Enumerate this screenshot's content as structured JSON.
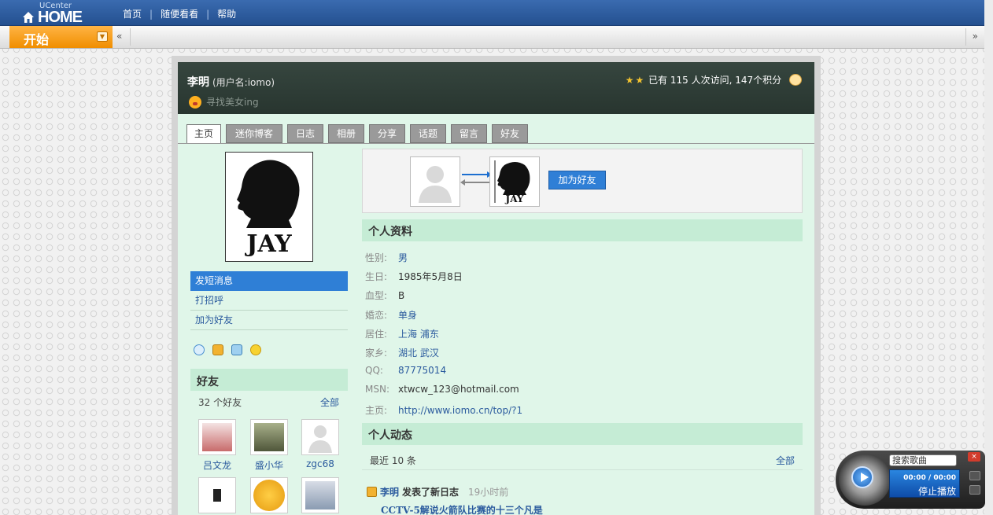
{
  "logo": {
    "small": "UCenter",
    "big": "HOME"
  },
  "topnav": [
    "首页",
    "随便看看",
    "帮助"
  ],
  "toolbar": {
    "start_label": "开始",
    "left_arrow": "«",
    "right_arrow": "»"
  },
  "profile": {
    "name": "李明",
    "username": "(用户名:iomo)",
    "motto": "寻找美女ing",
    "stats": "已有 115 人次访问, 147个积分",
    "avatar_text": "JAY"
  },
  "tabs": [
    "主页",
    "迷你博客",
    "日志",
    "相册",
    "分享",
    "话题",
    "留言",
    "好友"
  ],
  "actions": [
    "发短消息",
    "打招呼",
    "加为好友"
  ],
  "friends": {
    "title": "好友",
    "count": "32 个好友",
    "all": "全部",
    "list": [
      {
        "name": "吕文龙",
        "color": "#c86b6b"
      },
      {
        "name": "盛小华",
        "color": "#6f7a55"
      },
      {
        "name": "zgc68",
        "color": "#e3e3e3"
      },
      {
        "name": "",
        "color": "#222222"
      },
      {
        "name": "",
        "color": "#e59a10"
      },
      {
        "name": "",
        "color": "#8a9bb2"
      }
    ]
  },
  "relation": {
    "add_friend": "加为好友",
    "thumb_text": "JAY"
  },
  "personal_info": {
    "title": "个人资料",
    "rows": [
      {
        "k": "性别:",
        "v": "男",
        "link": true
      },
      {
        "k": "生日:",
        "v": "1985年5月8日",
        "link": false
      },
      {
        "k": "血型:",
        "v": "B",
        "link": false
      },
      {
        "k": "婚恋:",
        "v": "单身",
        "link": true
      },
      {
        "k": "居住:",
        "v": "上海  浦东",
        "link": true
      },
      {
        "k": "家乡:",
        "v": "湖北  武汉",
        "link": true
      },
      {
        "k": "QQ:",
        "v": "87775014",
        "link": true
      },
      {
        "k": "MSN:",
        "v": "xtwcw_123@hotmail.com",
        "link": false
      },
      {
        "k": "主页:",
        "v": "http://www.iomo.cn/top/?1",
        "link": true
      }
    ]
  },
  "activity": {
    "title": "个人动态",
    "meta": "最近  10 条",
    "all": "全部",
    "feed_user": "李明",
    "feed_action": "发表了新日志",
    "feed_time": "19小时前",
    "feed_title": "CCTV-5解说火箭队比赛的十三个凡是"
  },
  "player": {
    "search_label": "搜索歌曲",
    "time": "00:00 / 00:00",
    "status": "停止播放",
    "close": "×"
  },
  "colors": {
    "topbar": "#2d5e9e",
    "accent": "#2f7fd6",
    "start": "#f39c12",
    "panel": "#e0f6e9",
    "header": "#2f3d37"
  }
}
